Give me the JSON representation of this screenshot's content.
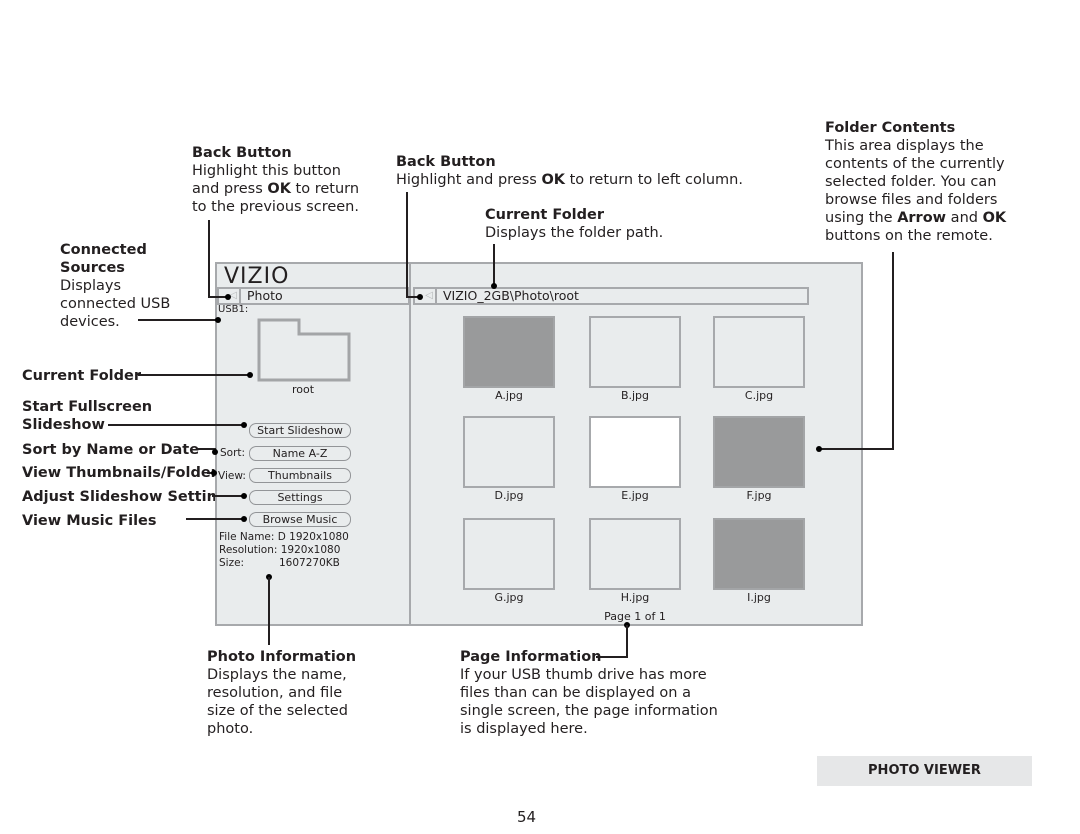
{
  "callouts": {
    "back_button_left": {
      "title": "Back Button",
      "lines": [
        "Highlight this button",
        "and press ",
        "OK",
        " to return",
        "to the previous screen."
      ]
    },
    "back_button_right": {
      "title": "Back Button",
      "pre": "Highlight and press ",
      "bold": "OK",
      "post": " to return to left column."
    },
    "current_folder_top": {
      "title": "Current Folder",
      "text": "Displays the folder path."
    },
    "folder_contents": {
      "title": "Folder Contents",
      "line1": "This area displays the",
      "line2": "contents of the currently",
      "line3": "selected folder. You can",
      "line4": "browse files and folders",
      "line5_pre": "using the ",
      "line5_bold1": "Arrow",
      "line5_mid": " and ",
      "line5_bold2": "OK",
      "line6": "buttons on the remote."
    },
    "connected_sources": {
      "title1": "Connected",
      "title2": "Sources",
      "line1": "Displays",
      "line2": "connected USB",
      "line3": "devices."
    },
    "current_folder_left": "Current Folder",
    "start_fullscreen_1": "Start Fullscreen",
    "start_fullscreen_2": "Slideshow",
    "sort_by": "Sort by Name or Date",
    "view_thumbnails": "View Thumbnails/Folders",
    "adjust_settings": "Adjust Slideshow Settings",
    "view_music": "View Music Files",
    "photo_information": {
      "title": "Photo Information",
      "line1": "Displays the name,",
      "line2": "resolution, and file",
      "line3": "size of the selected",
      "line4": "photo."
    },
    "page_information": {
      "title": "Page Information",
      "line1": "If your USB thumb drive has more",
      "line2": "files than can be displayed on a",
      "line3": "single screen, the page information",
      "line4": "is displayed here."
    }
  },
  "screen": {
    "logo": "VIZIO",
    "left_path": "Photo",
    "right_path": "VIZIO_2GB\\Photo\\root",
    "source_label": "USB1:",
    "folder_name": "root",
    "buttons": {
      "start_slideshow": "Start Slideshow",
      "sort_label": "Sort:",
      "sort_value": "Name A-Z",
      "view_label": "View:",
      "view_value": "Thumbnails",
      "settings": "Settings",
      "browse_music": "Browse Music"
    },
    "file_info": {
      "name": "File Name: D 1920x1080",
      "resolution": "Resolution: 1920x1080",
      "size_label": "Size:",
      "size_value": "1607270KB"
    },
    "thumbnails": [
      {
        "name": "A.jpg",
        "style": "gray"
      },
      {
        "name": "B.jpg",
        "style": "empty"
      },
      {
        "name": "C.jpg",
        "style": "empty"
      },
      {
        "name": "D.jpg",
        "style": "empty"
      },
      {
        "name": "E.jpg",
        "style": "white"
      },
      {
        "name": "F.jpg",
        "style": "gray"
      },
      {
        "name": "G.jpg",
        "style": "empty"
      },
      {
        "name": "H.jpg",
        "style": "empty"
      },
      {
        "name": "I.jpg",
        "style": "gray"
      }
    ],
    "page_info": "Page 1 of 1"
  },
  "footer": {
    "section_tab": "PHOTO VIEWER",
    "page_number": "54"
  }
}
